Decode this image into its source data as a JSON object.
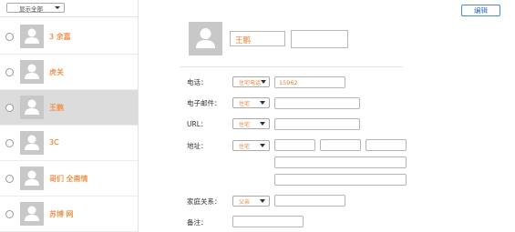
{
  "sidebar": {
    "filter_label": "显示全部",
    "contacts": [
      {
        "name": "3 余嘉"
      },
      {
        "name": "虎关"
      },
      {
        "name": "王鹏"
      },
      {
        "name": "3C"
      },
      {
        "name": "哥们 全斋情"
      },
      {
        "name": "苏博 网"
      }
    ]
  },
  "toolbar": {
    "edit_label": "编辑"
  },
  "detail": {
    "name": "王鹏",
    "phone_label": "电话：",
    "phone_type": "住宅电话",
    "phone_value": "15962",
    "email_label": "电子邮件：",
    "email_type": "住宅",
    "url_label": "URL：",
    "url_type": "住宅",
    "address_label": "地址：",
    "address_type": "住宅",
    "family_label": "家庭关系：",
    "family_type": "父亲",
    "notes_label": "备注："
  },
  "colors": {
    "accent": "#ee8133",
    "selected_row": "#dcdcdc",
    "button_border": "#4a8ad8"
  },
  "icons": {
    "avatar": "person-silhouette-icon",
    "dropdown": "triangle-down-icon"
  }
}
